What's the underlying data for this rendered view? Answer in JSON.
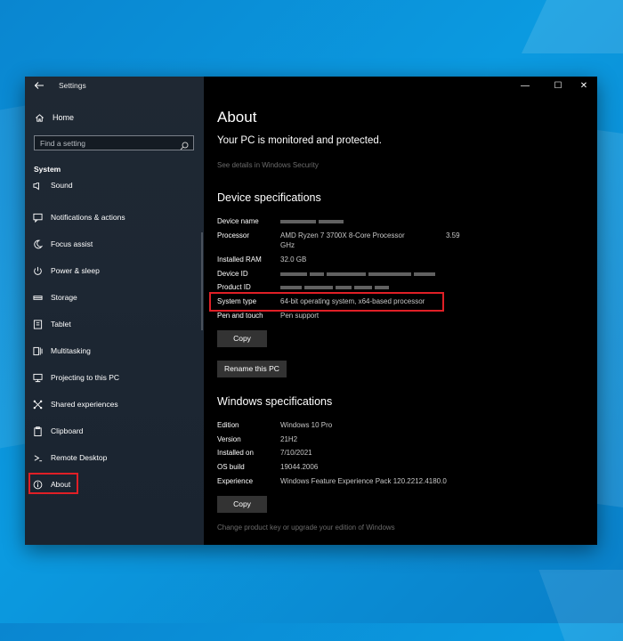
{
  "window": {
    "title": "Settings",
    "controls": {
      "minimize": "—",
      "maximize": "☐",
      "close": "✕"
    }
  },
  "sidebar": {
    "home_label": "Home",
    "search_placeholder": "Find a setting",
    "section_label": "System",
    "items": [
      {
        "label": "Sound",
        "icon": "speaker-icon"
      },
      {
        "label": "Notifications & actions",
        "icon": "notifications-icon"
      },
      {
        "label": "Focus assist",
        "icon": "moon-icon"
      },
      {
        "label": "Power & sleep",
        "icon": "power-icon"
      },
      {
        "label": "Storage",
        "icon": "storage-icon"
      },
      {
        "label": "Tablet",
        "icon": "tablet-icon"
      },
      {
        "label": "Multitasking",
        "icon": "multitasking-icon"
      },
      {
        "label": "Projecting to this PC",
        "icon": "projecting-icon"
      },
      {
        "label": "Shared experiences",
        "icon": "shared-icon"
      },
      {
        "label": "Clipboard",
        "icon": "clipboard-icon"
      },
      {
        "label": "Remote Desktop",
        "icon": "remote-desktop-icon"
      },
      {
        "label": "About",
        "icon": "info-icon"
      }
    ]
  },
  "main": {
    "page_title": "About",
    "protection_status": "Your PC is monitored and protected.",
    "security_link": "See details in Windows Security",
    "device_specs": {
      "heading": "Device specifications",
      "rows": [
        {
          "label": "Device name",
          "value": ""
        },
        {
          "label": "Processor",
          "value": "AMD Ryzen 7 3700X 8-Core Processor",
          "value_extra": "3.59",
          "value_line2": "GHz"
        },
        {
          "label": "Installed RAM",
          "value": "32.0 GB"
        },
        {
          "label": "Device ID",
          "value": ""
        },
        {
          "label": "Product ID",
          "value": ""
        },
        {
          "label": "System type",
          "value": "64-bit operating system, x64-based processor"
        },
        {
          "label": "Pen and touch",
          "value": "Pen support"
        }
      ],
      "copy_button": "Copy",
      "rename_button": "Rename this PC"
    },
    "windows_specs": {
      "heading": "Windows specifications",
      "rows": [
        {
          "label": "Edition",
          "value": "Windows 10 Pro"
        },
        {
          "label": "Version",
          "value": "21H2"
        },
        {
          "label": "Installed on",
          "value": "7/10/2021"
        },
        {
          "label": "OS build",
          "value": "19044.2006"
        },
        {
          "label": "Experience",
          "value": "Windows Feature Experience Pack 120.2212.4180.0"
        }
      ],
      "copy_button": "Copy"
    },
    "footer_link": "Change product key or upgrade your edition of Windows"
  },
  "colors": {
    "highlight_border": "#e01f26",
    "desktop_blue": "#0a86d0",
    "sidebar_bg": "#1f2833"
  }
}
